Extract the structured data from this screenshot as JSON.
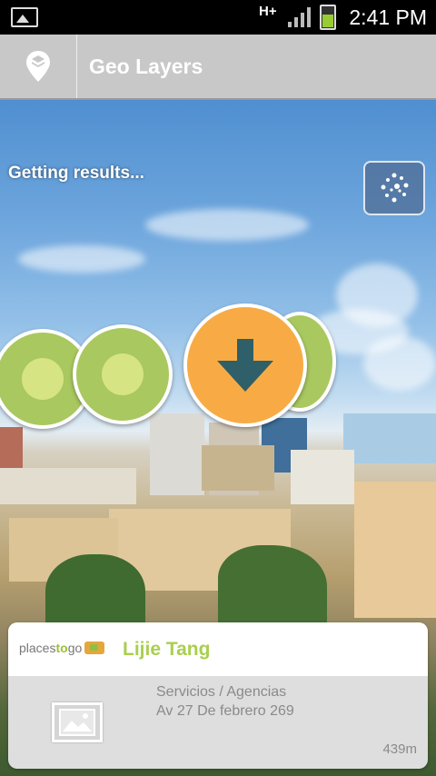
{
  "status_bar": {
    "network": "H+",
    "time": "2:41 PM"
  },
  "action_bar": {
    "title": "Geo Layers",
    "icon": "layers-pin-icon"
  },
  "ar_view": {
    "status_message": "Getting results...",
    "radar_icon": "radar-dots-icon",
    "markers": [
      {
        "type": "green"
      },
      {
        "type": "green"
      },
      {
        "type": "green"
      },
      {
        "type": "orange",
        "icon": "arrow-down-icon"
      }
    ]
  },
  "result_card": {
    "brand": {
      "part1": "places",
      "part2": "to",
      "part3": "go"
    },
    "name": "Lijie Tang",
    "category": "Servicios / Agencias",
    "address": "Av 27 De febrero 269",
    "distance": "439m",
    "thumbnail_icon": "image-placeholder-icon"
  },
  "colors": {
    "accent_green": "#a9cf4e",
    "marker_orange": "#f8ab45",
    "actionbar": "#c8c8c8"
  }
}
